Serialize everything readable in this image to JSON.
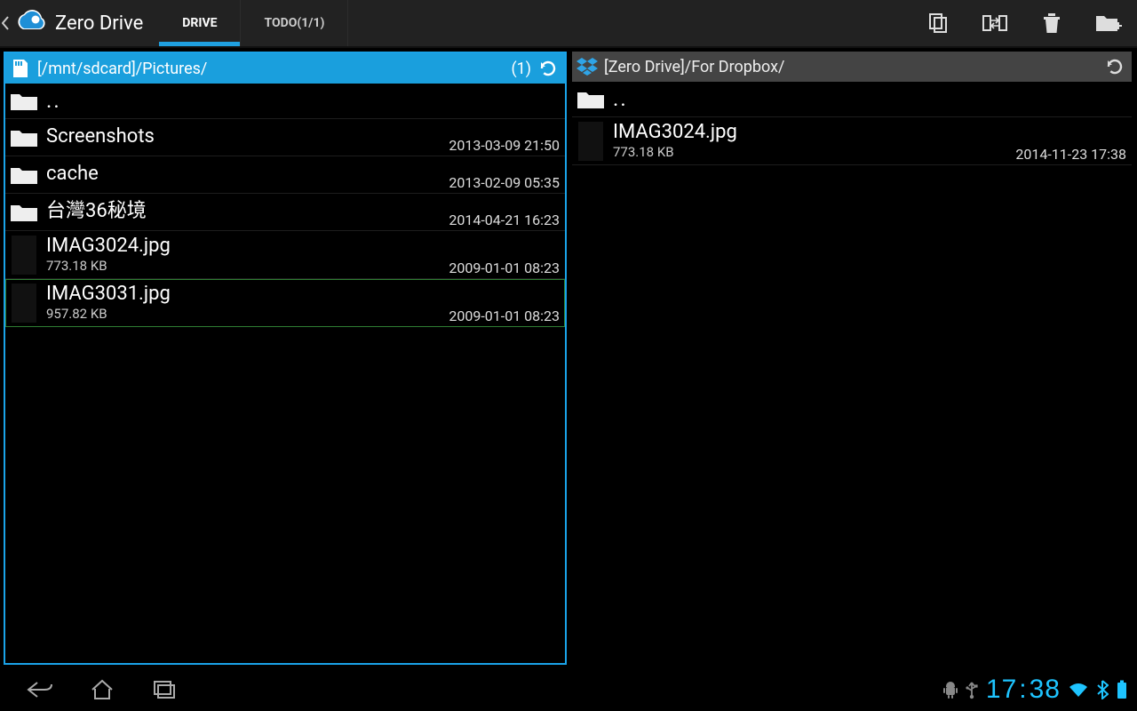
{
  "app": {
    "title": "Zero Drive"
  },
  "tabs": {
    "drive": "DRIVE",
    "todo": "TODO(1/1)"
  },
  "left": {
    "path": "[/mnt/sdcard]/Pictures/",
    "count": "(1)",
    "up": "..",
    "items": [
      {
        "name": "Screenshots",
        "date": "2013-03-09 21:50"
      },
      {
        "name": "cache",
        "date": "2013-02-09 05:35"
      },
      {
        "name": "台灣36秘境",
        "date": "2014-04-21 16:23"
      }
    ],
    "files": [
      {
        "name": "IMAG3024.jpg",
        "size": "773.18 KB",
        "date": "2009-01-01 08:23"
      },
      {
        "name": "IMAG3031.jpg",
        "size": "957.82 KB",
        "date": "2009-01-01 08:23"
      }
    ]
  },
  "right": {
    "path": "[Zero Drive]/For Dropbox/",
    "up": "..",
    "files": [
      {
        "name": "IMAG3024.jpg",
        "size": "773.18 KB",
        "date": "2014-11-23 17:38"
      }
    ]
  },
  "status": {
    "time_h": "17",
    "time_m": "38"
  }
}
